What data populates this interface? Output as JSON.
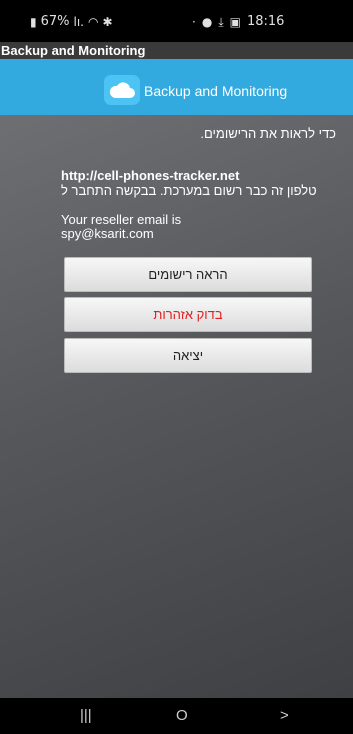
{
  "status_bar": {
    "battery": "67%",
    "time": "18:16",
    "icons": [
      "battery-icon",
      "signal-icon",
      "wifi-icon",
      "bluetooth-icon",
      "notification-dot-icon",
      "download-icon",
      "image-icon"
    ]
  },
  "title_bar": {
    "title": "Backup and Monitoring"
  },
  "app_header": {
    "title": "Backup and Monitoring",
    "logo_icon": "cloud-icon"
  },
  "content": {
    "intro": "כדי לראות את הרישומים.",
    "site_url": "http://cell-phones-tracker.net",
    "registered_line": "טלפון זה כבר רשום במערכת. בבקשה התחבר ל",
    "reseller_label": "Your reseller email is",
    "reseller_email": "spy@ksarit.com"
  },
  "buttons": {
    "show_records": "הראה רישומים",
    "check_alerts": "בדוק אזהרות",
    "exit": "יציאה"
  },
  "nav_bar": {
    "recents": "|||",
    "home": "O",
    "back": ">"
  },
  "colors": {
    "header": "#33aadf",
    "alert_text": "#e02020",
    "background": "#55575a"
  }
}
